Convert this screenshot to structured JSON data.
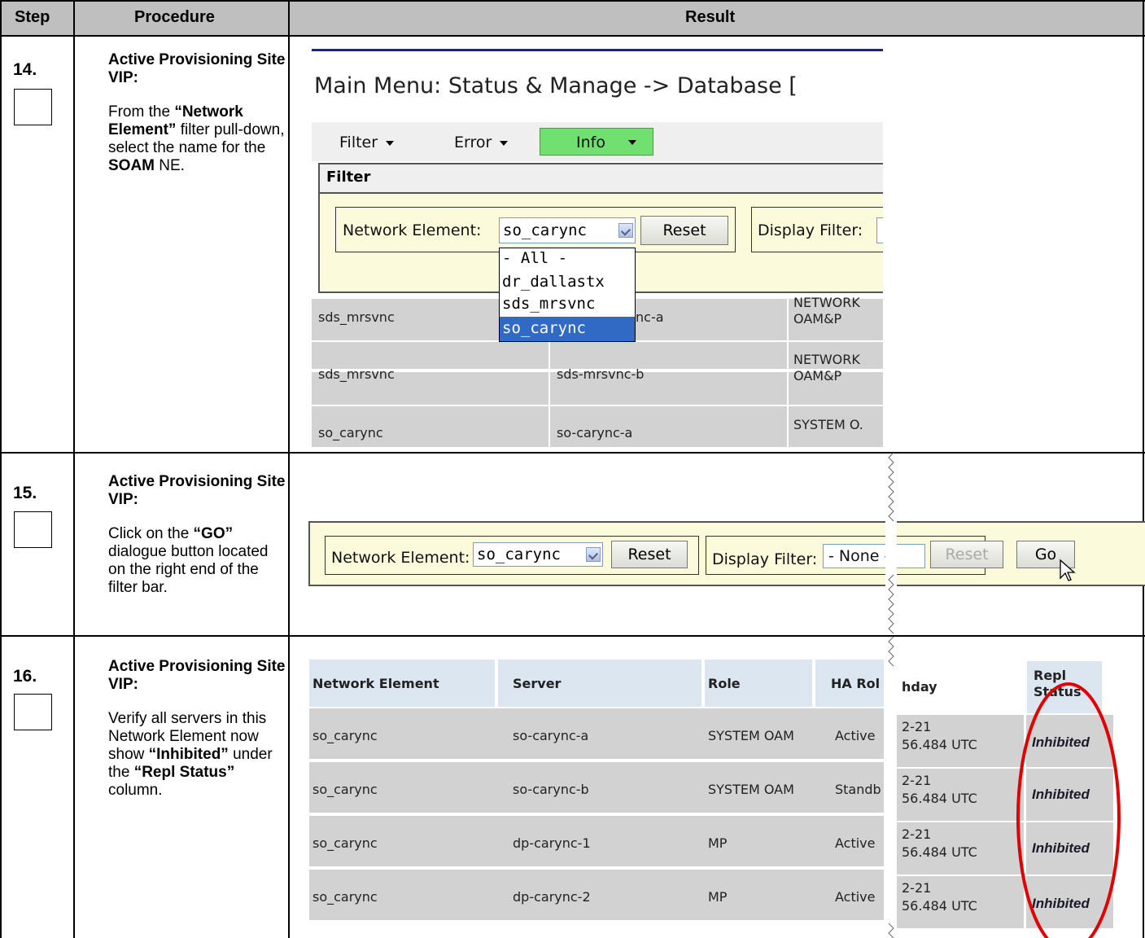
{
  "table": {
    "headers": {
      "step": "Step",
      "procedure": "Procedure",
      "result": "Result"
    },
    "rows": [
      {
        "num": "14.",
        "title": "Active Provisioning Site VIP:",
        "body": [
          "From the ",
          "“Network Element”",
          " filter pull-down, select the name for the ",
          "SOAM",
          " NE."
        ]
      },
      {
        "num": "15.",
        "title": "Active Provisioning Site VIP:",
        "body": [
          "Click on the ",
          "“GO”",
          " dialogue button located on the right end of the filter bar."
        ]
      },
      {
        "num": "16.",
        "title": "Active Provisioning Site VIP:",
        "body": [
          "Verify all servers in this Network Element now show ",
          "“Inhibited”",
          " under the ",
          "“Repl Status”",
          " column."
        ]
      }
    ]
  },
  "shot14": {
    "title": "Main Menu: Status & Manage -> Database [",
    "toolbar": {
      "filter": "Filter",
      "error": "Error",
      "info": "Info"
    },
    "filter_heading": "Filter",
    "ne_label": "Network Element:",
    "ne_value": "so_carync",
    "reset": "Reset",
    "display_filter": "Display Filter:",
    "dropdown_options": [
      "- All -",
      "dr_dallastx",
      "sds_mrsvnc",
      "so_carync"
    ],
    "rows": [
      {
        "ne": "sds_mrsvnc",
        "server": "nc-a",
        "role": [
          "NETWORK",
          "OAM&P"
        ]
      },
      {
        "ne": "sds_mrsvnc",
        "server": "sds-mrsvnc-b",
        "role": [
          "NETWORK",
          "OAM&P"
        ]
      },
      {
        "ne": "so_carync",
        "server": "so-carync-a",
        "role": [
          "SYSTEM O."
        ]
      }
    ]
  },
  "shot15": {
    "ne_label": "Network Element:",
    "ne_value": "so_carync",
    "reset": "Reset",
    "display_filter": "Display Filter:",
    "display_value": "- None -",
    "reset2": "Reset",
    "go": "Go"
  },
  "shot16": {
    "headers": [
      "Network Element",
      "Server",
      "Role",
      "HA Rol",
      "hday",
      "Repl",
      "Status"
    ],
    "rows": [
      {
        "ne": "so_carync",
        "server": "so-carync-a",
        "role": "SYSTEM OAM",
        "ha": "Active",
        "date": "2-21",
        "time": "56.484 UTC",
        "repl": "Inhibited"
      },
      {
        "ne": "so_carync",
        "server": "so-carync-b",
        "role": "SYSTEM OAM",
        "ha": "Standb",
        "date": "2-21",
        "time": "56.484 UTC",
        "repl": "Inhibited"
      },
      {
        "ne": "so_carync",
        "server": "dp-carync-1",
        "role": "MP",
        "ha": "Active",
        "date": "2-21",
        "time": "56.484 UTC",
        "repl": "Inhibited"
      },
      {
        "ne": "so_carync",
        "server": "dp-carync-2",
        "role": "MP",
        "ha": "Active",
        "date": "2-21",
        "time": "56.484 UTC",
        "repl": "Inhibited"
      }
    ]
  },
  "colors": {
    "header_bg": "#bfbfbf",
    "filter_bg": "#fbfbdc",
    "info_green": "#70e070",
    "highlight_blue": "#316ac5",
    "annotation_red": "#e00000",
    "row_gray": "#d2d2d2"
  }
}
